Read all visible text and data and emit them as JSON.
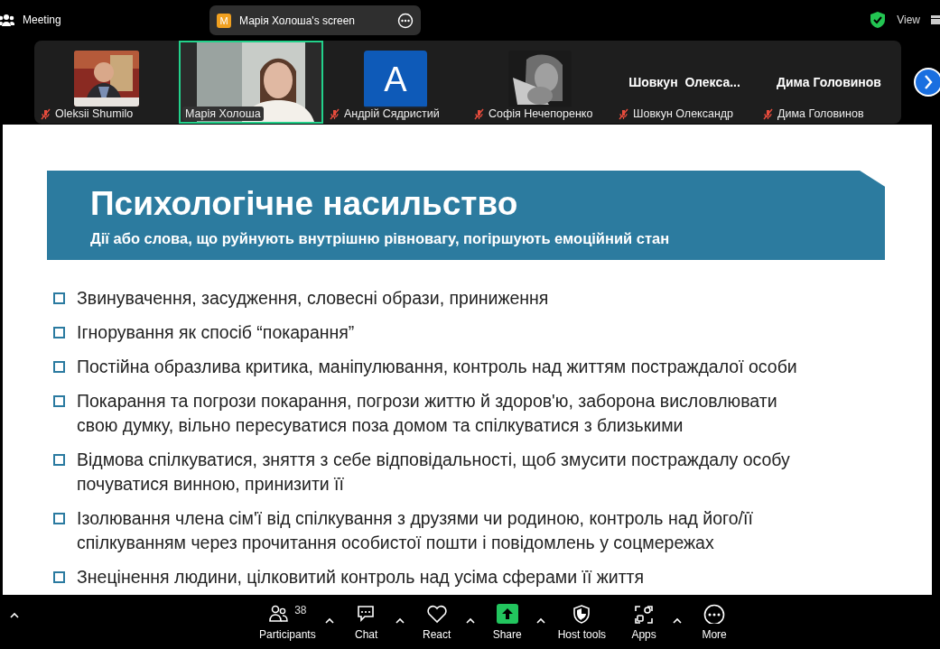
{
  "top_bar": {
    "title": "Meeting",
    "share_banner": {
      "initial": "M",
      "text": "Марія Холоша's screen"
    },
    "view_label": "View"
  },
  "participants": [
    {
      "kind": "video",
      "name": "Oleksii Shumilo",
      "muted": true,
      "selected": false
    },
    {
      "kind": "video_full",
      "name": "Марія Холоша",
      "muted": false,
      "selected": true
    },
    {
      "kind": "avatar",
      "initial": "A",
      "name": "Андрій Сядристий",
      "muted": true,
      "selected": false
    },
    {
      "kind": "video",
      "name": "Софія Нечепоренко",
      "muted": true,
      "selected": false
    },
    {
      "kind": "name",
      "display": "Шовкун  Олекса...",
      "name": "Шовкун Олександр",
      "muted": true,
      "selected": false
    },
    {
      "kind": "name",
      "display": "Дима Головинов",
      "name": "Дима Головинов",
      "muted": true,
      "selected": false
    }
  ],
  "slide": {
    "title": "Психологічне насильство",
    "subtitle": "Дії або слова, що руйнують внутрішню рівновагу, погіршують емоційний стан",
    "bullets": [
      {
        "lines": [
          "Звинувачення, засудження, словесні образи, приниження"
        ]
      },
      {
        "lines": [
          "Ігнорування як спосіб “покарання”"
        ]
      },
      {
        "lines": [
          "Постійна образлива критика, маніпулювання, контроль над життям постраждалої особи"
        ]
      },
      {
        "lines": [
          "Покарання та погрози покарання, погрози життю й здоров'ю, заборона висловлювати",
          "свою думку, вільно пересуватися поза домом та спілкуватися з близькими"
        ]
      },
      {
        "lines": [
          "Відмова спілкуватися, зняття з себе відповідальності, щоб змусити постраждалу особу",
          "почуватися винною, принизити її"
        ]
      },
      {
        "lines": [
          "Ізолювання члена сім'ї від спілкування з друзями чи родиною, контроль над його/її",
          "спілкуванням через прочитання особистої пошти і повідомлень у соцмережах"
        ]
      },
      {
        "lines": [
          "Знецінення людини, цілковитий контроль над усіма сферами її життя"
        ]
      }
    ]
  },
  "toolbar": [
    {
      "kind": "participants",
      "label": "Participants",
      "count": "38",
      "caret": true
    },
    {
      "kind": "chat",
      "label": "Chat",
      "caret": true
    },
    {
      "kind": "react",
      "label": "React",
      "caret": true
    },
    {
      "kind": "share",
      "label": "Share",
      "caret": true
    },
    {
      "kind": "host",
      "label": "Host tools",
      "caret": false
    },
    {
      "kind": "apps",
      "label": "Apps",
      "caret": true
    },
    {
      "kind": "more",
      "label": "More",
      "caret": false
    }
  ]
}
